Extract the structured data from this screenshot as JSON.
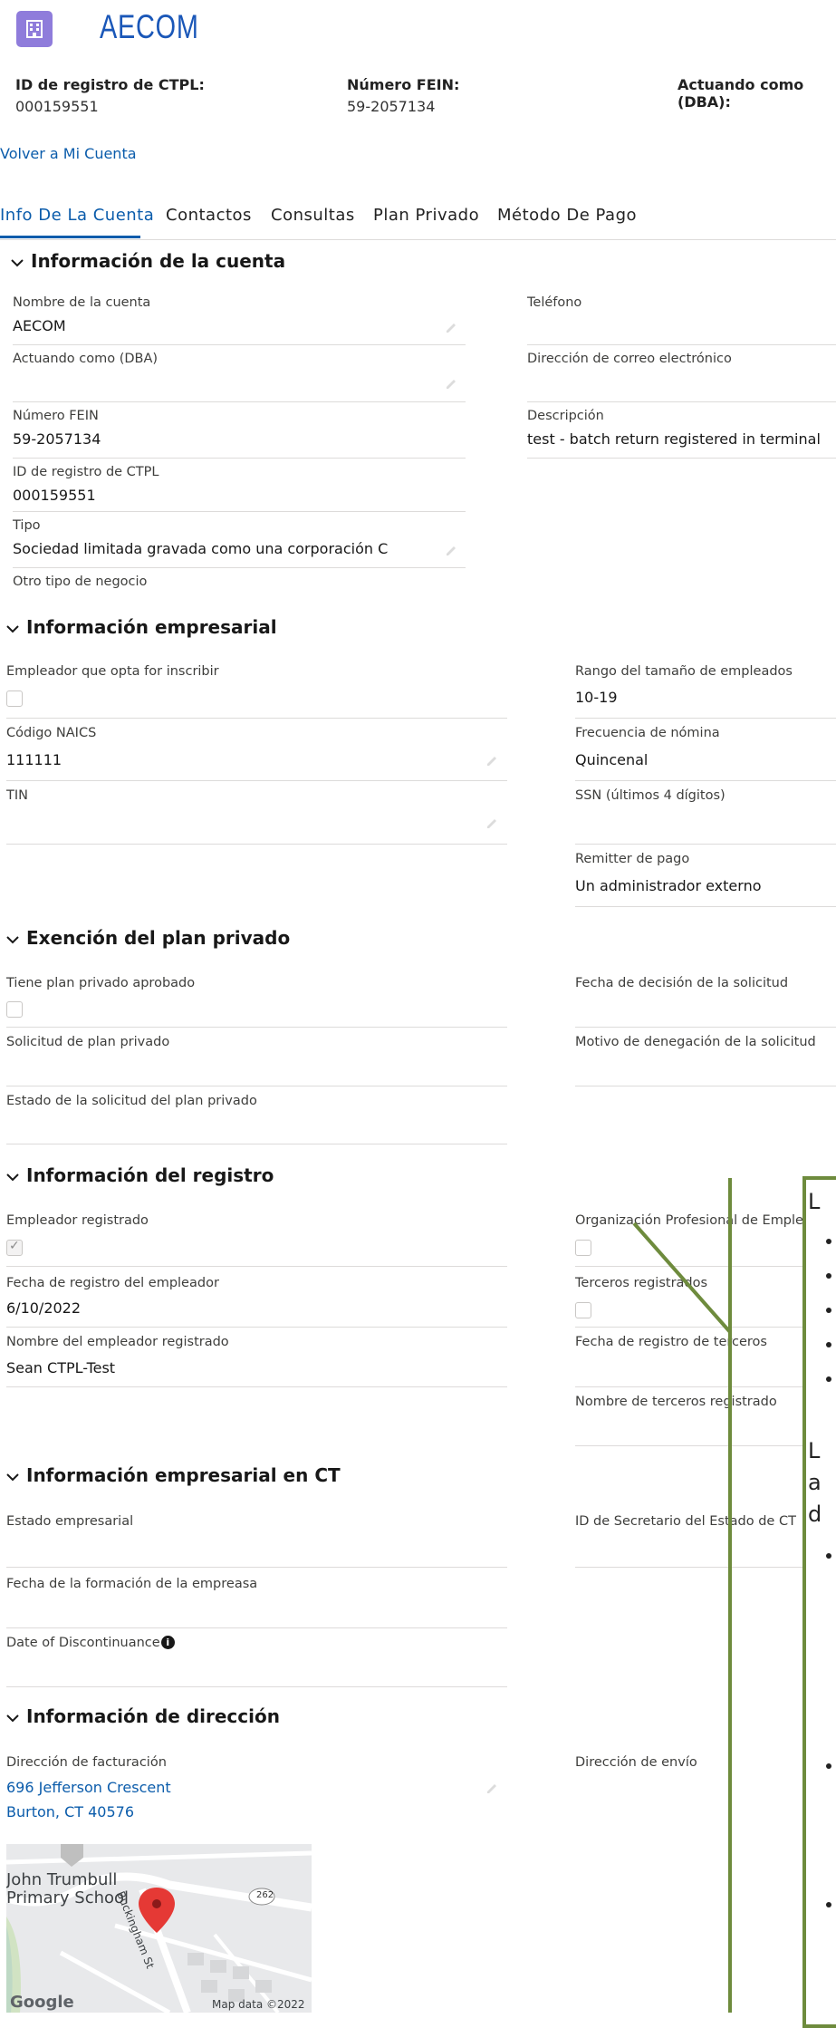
{
  "brand": {
    "name": "AECOM"
  },
  "header": {
    "ctpl_label": "ID de registro de CTPL:",
    "ctpl_value": "000159551",
    "fein_label": "Número FEIN:",
    "fein_value": "59-2057134",
    "dba_label": "Actuando como (DBA):"
  },
  "back_link": "Volver a Mi Cuenta",
  "tabs": [
    "Info De La Cuenta",
    "Contactos",
    "Consultas",
    "Plan Privado",
    "Método De Pago"
  ],
  "account_info": {
    "title": "Información de la cuenta",
    "account_name_label": "Nombre de la cuenta",
    "account_name_value": "AECOM",
    "phone_label": "Teléfono",
    "dba_label": "Actuando como (DBA)",
    "email_label": "Dirección de correo electrónico",
    "fein_label": "Número FEIN",
    "fein_value": "59-2057134",
    "description_label": "Descripción",
    "description_value": "test - batch return registered in terminal",
    "ctpl_label": "ID de registro de CTPL",
    "ctpl_value": "000159551",
    "type_label": "Tipo",
    "type_value": "Sociedad limitada gravada como una corporación C",
    "other_type_label": "Otro tipo de negocio"
  },
  "business_info": {
    "title": "Información empresarial",
    "opt_in_label": "Empleador que opta for inscribir",
    "size_label": "Rango del tamaño de empleados",
    "size_value": "10-19",
    "naics_label": "Código NAICS",
    "naics_value": "111111",
    "payroll_label": "Frecuencia de nómina",
    "payroll_value": "Quincenal",
    "tin_label": "TIN",
    "ssn_label": "SSN (últimos 4 dígitos)",
    "remitter_label": "Remitter de pago",
    "remitter_value": "Un administrador externo"
  },
  "private_plan": {
    "title": "Exención del plan privado",
    "has_plan_label": "Tiene plan privado aprobado",
    "decision_date_label": "Fecha de decisión de la solicitud",
    "request_label": "Solicitud de plan privado",
    "denial_reason_label": "Motivo de denegación de la solicitud",
    "status_label": "Estado de la solicitud del plan privado"
  },
  "registration": {
    "title": "Información del registro",
    "registered_employer_label": "Empleador registrado",
    "peo_label": "Organización Profesional de Emple",
    "reg_date_label": "Fecha de registro del empleador",
    "reg_date_value": "6/10/2022",
    "third_party_label": "Terceros registrados",
    "employer_name_label": "Nombre del empleador registrado",
    "employer_name_value": "Sean CTPL-Test",
    "third_party_date_label": "Fecha de registro de terceros",
    "third_party_name_label": "Nombre de terceros registrado"
  },
  "ct_business": {
    "title": "Información empresarial en CT",
    "status_label": "Estado empresarial",
    "sos_id_label": "ID de Secretario del Estado de CT",
    "formation_label": "Fecha de la formación de la empreasa",
    "discontinuance_label": "Date of Discontinuance"
  },
  "address": {
    "title": "Información de dirección",
    "billing_label": "Dirección de facturación",
    "billing_line1": "696 Jefferson Crescent",
    "billing_line2": "Burton, CT 40576",
    "shipping_label": "Dirección de envío"
  },
  "map": {
    "school": "John Trumbull Primary School",
    "street": "Buckingham St",
    "route": "262",
    "attribution": "Map data ©2022",
    "google": "Google"
  },
  "overlay": {
    "letter1": "L",
    "letter2": "L",
    "letter3": "a",
    "letter4": "d"
  },
  "colors": {
    "accent": "#0b5cab",
    "overlay_green": "#6e8b3d",
    "logo": "#8f7cdb"
  }
}
